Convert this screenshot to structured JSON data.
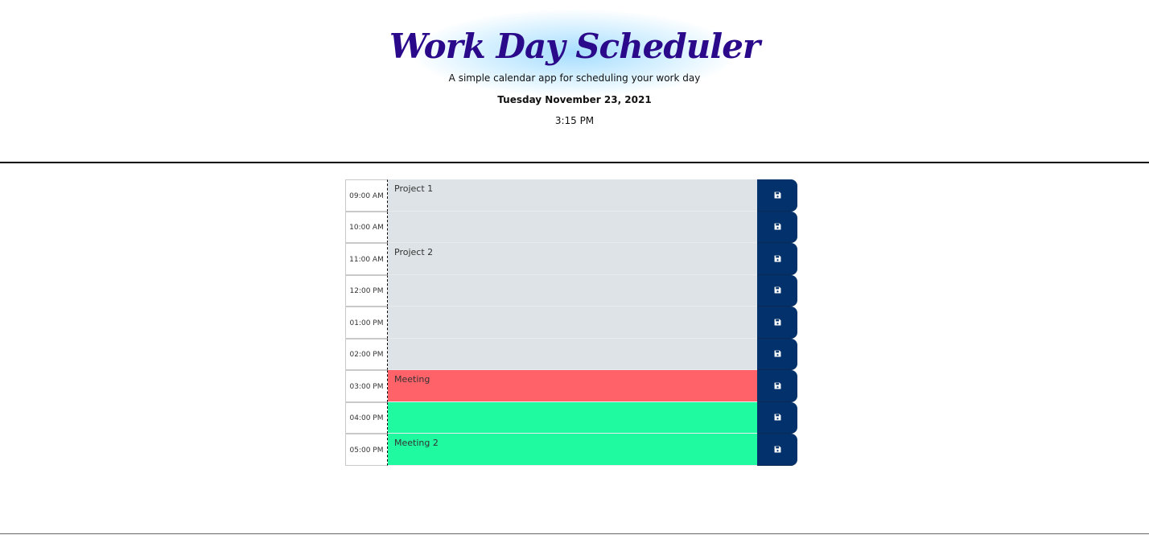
{
  "header": {
    "title": "Work Day Scheduler",
    "subtitle": "A simple calendar app for scheduling your work day",
    "date": "Tuesday November 23, 2021",
    "time": "3:15 PM"
  },
  "colors": {
    "past": "#dde3e6",
    "present": "#ff6269",
    "future": "#1ff9a0",
    "save_button": "#03316b",
    "title": "#2a0a8a"
  },
  "icons": {
    "save": "floppy-disk-icon"
  },
  "rows": [
    {
      "hour": "09:00 AM",
      "text": "Project 1",
      "state": "past"
    },
    {
      "hour": "10:00 AM",
      "text": "",
      "state": "past"
    },
    {
      "hour": "11:00 AM",
      "text": "Project 2",
      "state": "past"
    },
    {
      "hour": "12:00 PM",
      "text": "",
      "state": "past"
    },
    {
      "hour": "01:00 PM",
      "text": "",
      "state": "past"
    },
    {
      "hour": "02:00 PM",
      "text": "",
      "state": "past"
    },
    {
      "hour": "03:00 PM",
      "text": "Meeting",
      "state": "present"
    },
    {
      "hour": "04:00 PM",
      "text": "",
      "state": "future"
    },
    {
      "hour": "05:00 PM",
      "text": "Meeting 2",
      "state": "future"
    }
  ]
}
